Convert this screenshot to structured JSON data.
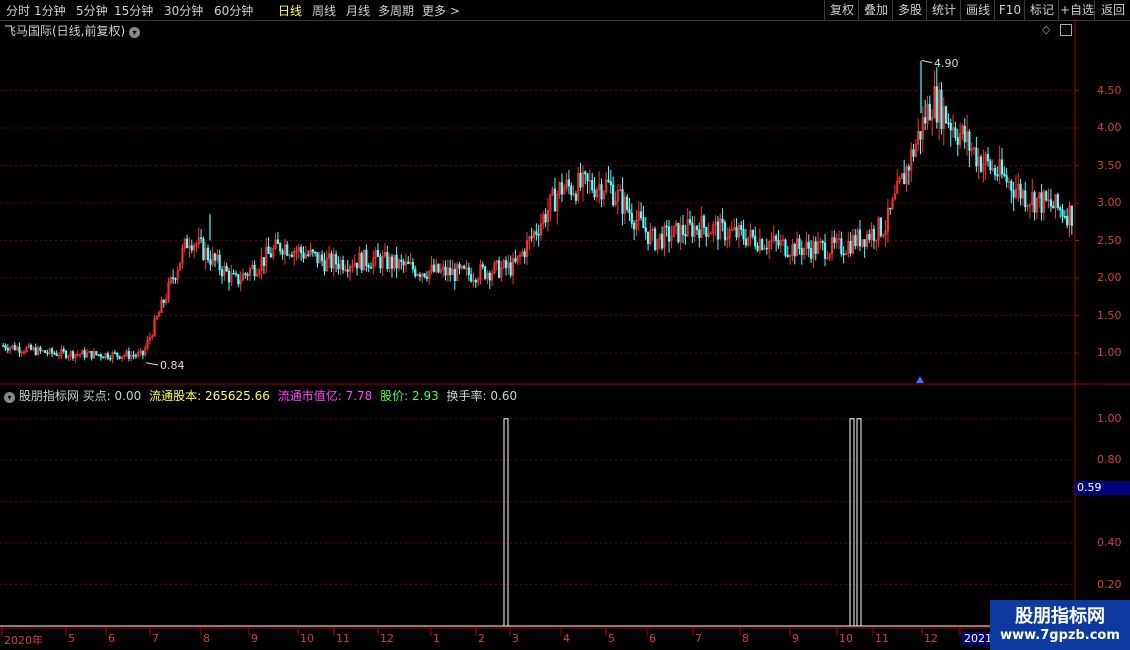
{
  "toolbar": {
    "periods": [
      "分时",
      "1分钟",
      "5分钟",
      "15分钟",
      "30分钟",
      "60分钟",
      "日线",
      "周线",
      "月线",
      "多周期",
      "更多 >"
    ],
    "active_index": 6,
    "right_buttons": [
      "复权",
      "叠加",
      "多股",
      "统计",
      "画线",
      "F10",
      "标记",
      "+自选",
      "返回"
    ]
  },
  "main_panel": {
    "title": "飞马国际(日线,前复权)",
    "high_label": "4.90",
    "low_label": "0.84",
    "y_ticks": [
      "4.50",
      "4.00",
      "3.50",
      "3.00",
      "2.50",
      "2.00",
      "1.50",
      "1.00"
    ]
  },
  "indicator_panel": {
    "name": "股朋指标网",
    "buy_label": "买点:",
    "buy_value": "0.00",
    "float_label": "流通股本:",
    "float_value": "265625.66",
    "cap_label": "流通市值亿:",
    "cap_value": "7.78",
    "price_label": "股价:",
    "price_value": "2.93",
    "turnover_label": "换手率:",
    "turnover_value": "0.60",
    "y_ticks": [
      "1.00",
      "0.80",
      "0.40",
      "0.20"
    ],
    "current_value": "0.59"
  },
  "x_axis": {
    "labels": [
      "2020年",
      "5",
      "6",
      "7",
      "8",
      "9",
      "10",
      "11",
      "12",
      "1",
      "2",
      "3",
      "4",
      "5",
      "6",
      "7",
      "8",
      "9",
      "10",
      "11",
      "12",
      "2021"
    ]
  },
  "watermark": {
    "line1": "股朋指标网",
    "line2": "www.7gpzb.com"
  },
  "colors": {
    "up": "#ff3232",
    "down": "#54ffff",
    "axis": "#b00000",
    "grid": "#6a0000"
  },
  "chart_data": [
    {
      "type": "candlestick",
      "title": "飞马国际(日线,前复权)",
      "ylim": [
        0.6,
        5.2
      ],
      "x": [
        "2020-03",
        "2020-05",
        "2020-06",
        "2020-07",
        "2020-08",
        "2020-09",
        "2020-10",
        "2020-11",
        "2020-12",
        "2021-01",
        "2021-02",
        "2021-03",
        "2021-04",
        "2021-05",
        "2021-06",
        "2021-07",
        "2021-08",
        "2021-09",
        "2021-10",
        "2021-11",
        "2021-12",
        "2022-01"
      ],
      "close_path": [
        1.1,
        1.0,
        0.98,
        0.97,
        2.55,
        1.95,
        2.45,
        2.2,
        2.25,
        2.1,
        2.05,
        2.15,
        3.2,
        3.25,
        2.5,
        2.7,
        2.55,
        2.4,
        2.4,
        2.7,
        4.4,
        3.6,
        3.1,
        2.85
      ],
      "annotations": [
        {
          "label": "4.90",
          "type": "high"
        },
        {
          "label": "0.84",
          "type": "low"
        }
      ]
    },
    {
      "type": "bar",
      "title": "股朋指标网",
      "ylim": [
        0,
        1.1
      ],
      "signals": [
        {
          "date": "2021-03",
          "value": 1.0
        },
        {
          "date": "2021-11",
          "value": 1.0
        },
        {
          "date": "2021-11",
          "value": 1.0
        }
      ]
    }
  ]
}
